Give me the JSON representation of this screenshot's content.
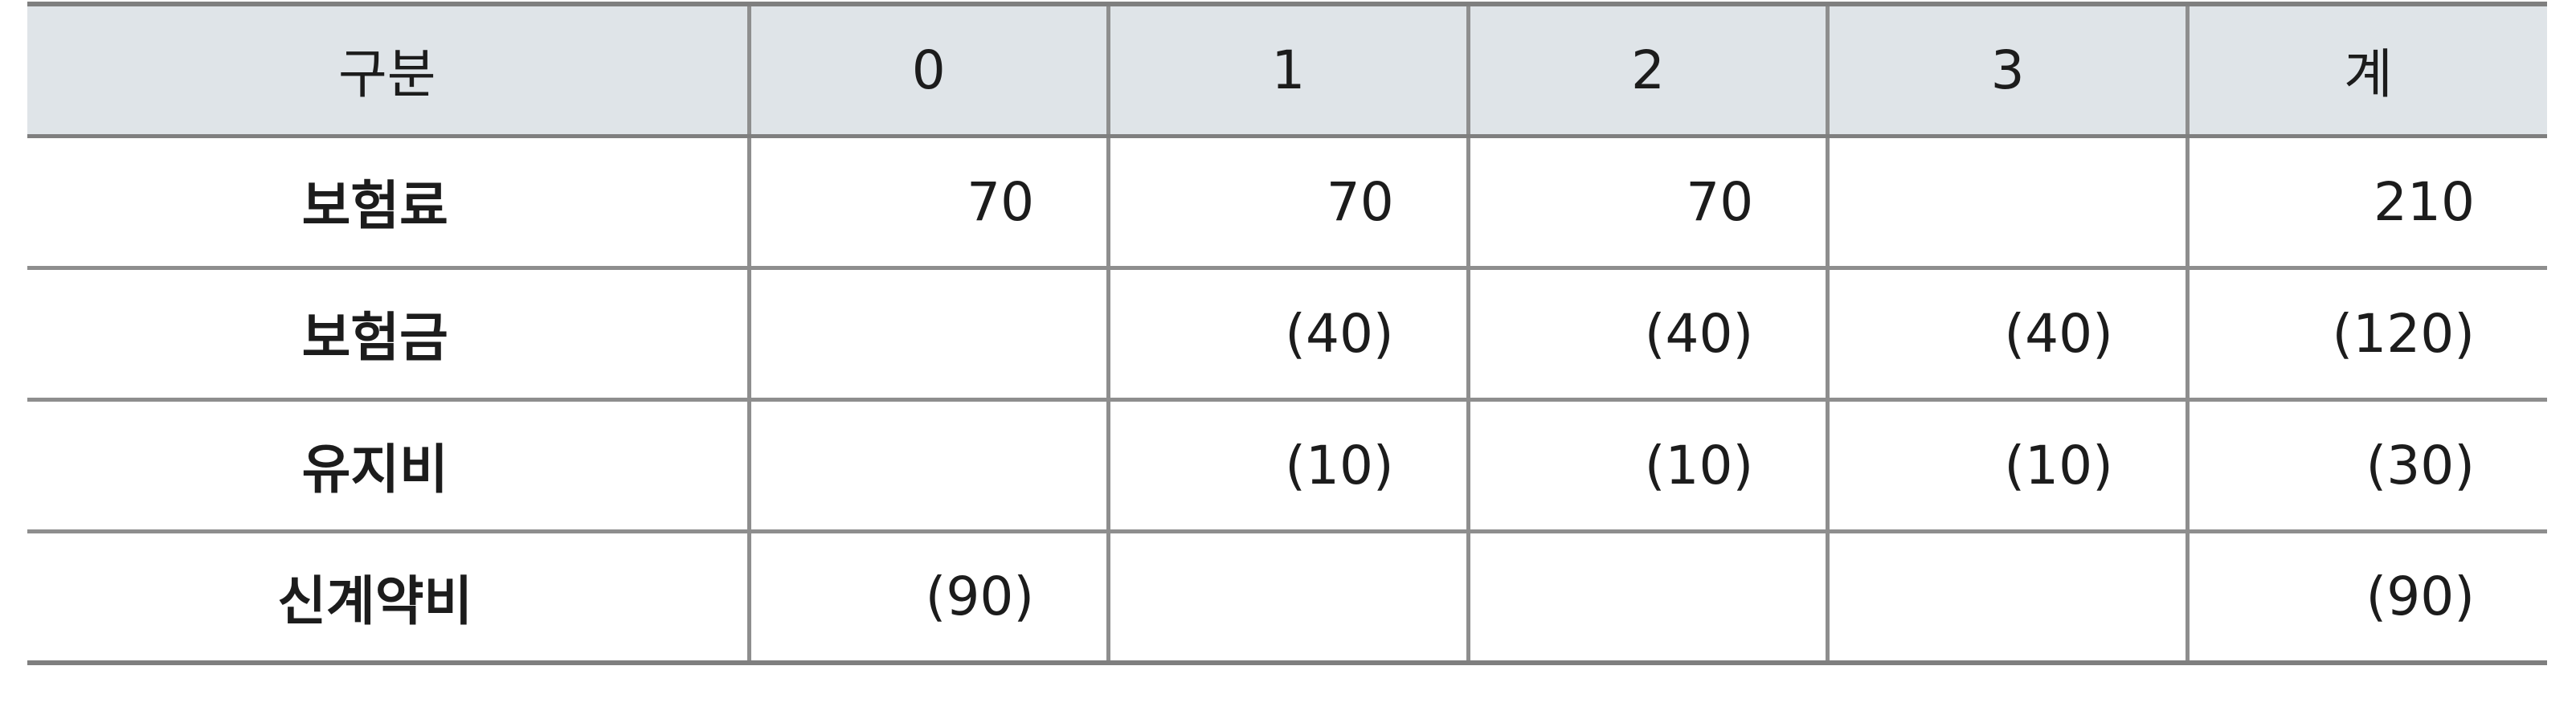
{
  "table": {
    "headers": [
      "구분",
      "0",
      "1",
      "2",
      "3",
      "계"
    ],
    "rows": [
      {
        "label": "보험료",
        "cells": [
          "70",
          "70",
          "70",
          "",
          "210"
        ]
      },
      {
        "label": "보험금",
        "cells": [
          "",
          "(40)",
          "(40)",
          "(40)",
          "(120)"
        ]
      },
      {
        "label": "유지비",
        "cells": [
          "",
          "(10)",
          "(10)",
          "(10)",
          "(30)"
        ]
      },
      {
        "label": "신계약비",
        "cells": [
          "(90)",
          "",
          "",
          "",
          "(90)"
        ]
      }
    ]
  },
  "colors": {
    "header_background": "#dfe4e8",
    "border": "#8e8e8e",
    "text": "#1c1c1c"
  }
}
